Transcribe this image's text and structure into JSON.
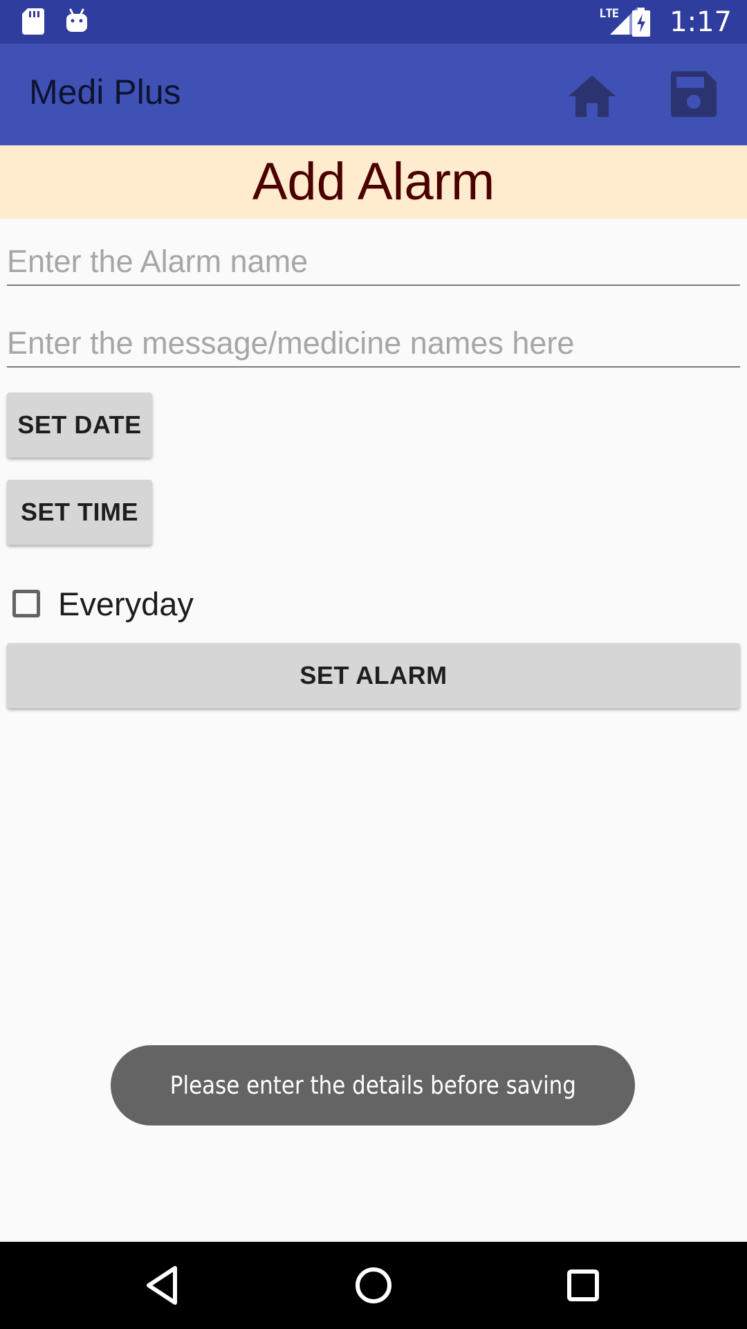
{
  "status_bar": {
    "time": "1:17",
    "network": "LTE",
    "left_icons": [
      "sd-card-icon",
      "android-icon"
    ],
    "right_icons": [
      "lte-signal-icon",
      "battery-charging-icon"
    ]
  },
  "app_bar": {
    "title": "Medi Plus",
    "actions": [
      "home-icon",
      "save-icon"
    ]
  },
  "header": {
    "title": "Add Alarm"
  },
  "form": {
    "alarm_name": {
      "value": "",
      "placeholder": "Enter the Alarm name"
    },
    "message": {
      "value": "",
      "placeholder": "Enter the message/medicine names here"
    },
    "set_date_label": "SET DATE",
    "set_time_label": "SET TIME",
    "everyday_label": "Everyday",
    "everyday_checked": false,
    "set_alarm_label": "SET ALARM"
  },
  "toast": {
    "message": "Please enter the details before saving"
  },
  "nav_bar": {
    "buttons": [
      "back-icon",
      "home-circle-icon",
      "recents-icon"
    ]
  },
  "colors": {
    "status_bar": "#2f3e9e",
    "app_bar": "#3f51b5",
    "header_band": "#ffebcd",
    "header_text": "#4b0000",
    "button_bg": "#d6d6d6",
    "toast_bg": "#646464",
    "nav_bar": "#000000"
  }
}
